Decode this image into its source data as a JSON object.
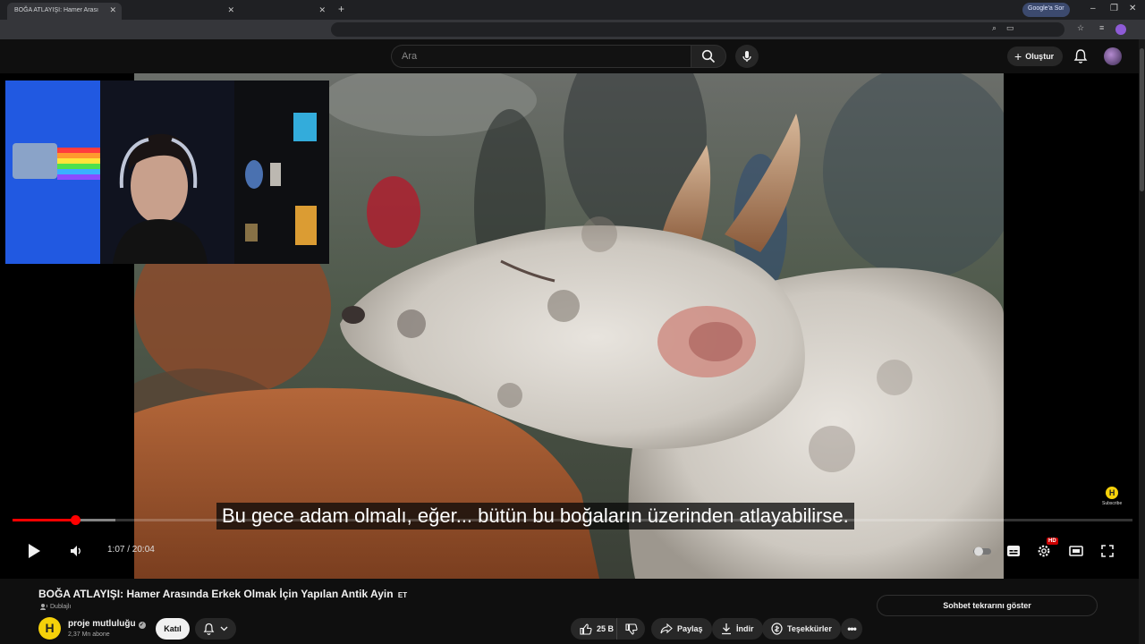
{
  "browser": {
    "tabs": [
      {
        "title": "BOĞA ATLAYIŞI: Hamer Arası"
      },
      {
        "title": ""
      },
      {
        "title": ""
      }
    ],
    "google_sor_label": "Google'a Sor"
  },
  "youtube": {
    "search_placeholder": "Ara",
    "create_label": "Oluştur"
  },
  "player": {
    "caption": "Bu gece adam olmalı, eğer... bütün bu boğaların üzerinden atlayabilirse.",
    "time_display": "1:07 / 20:04",
    "progress_fraction": 0.0556,
    "hd_badge": "HD",
    "watermark_label": "Subscribe"
  },
  "video_info": {
    "title": "BOĞA ATLAYIŞI: Hamer Arasında Erkek Olmak İçin Yapılan Antik Ayin",
    "title_badge": "ET",
    "dub_label": "Dublajlı",
    "channel_name": "proje mutluluğu",
    "channel_initial": "H",
    "subscribers": "2,37 Mn abone",
    "join_label": "Katıl",
    "like_count": "25 B",
    "share_label": "Paylaş",
    "download_label": "İndir",
    "thanks_label": "Teşekkürler",
    "chat_replay_label": "Sohbet tekrarını göster"
  },
  "colors": {
    "accent_red": "#ff0000",
    "background": "#0f0f0f",
    "button_bg": "#272727",
    "channel_yellow": "#f5d10a"
  }
}
